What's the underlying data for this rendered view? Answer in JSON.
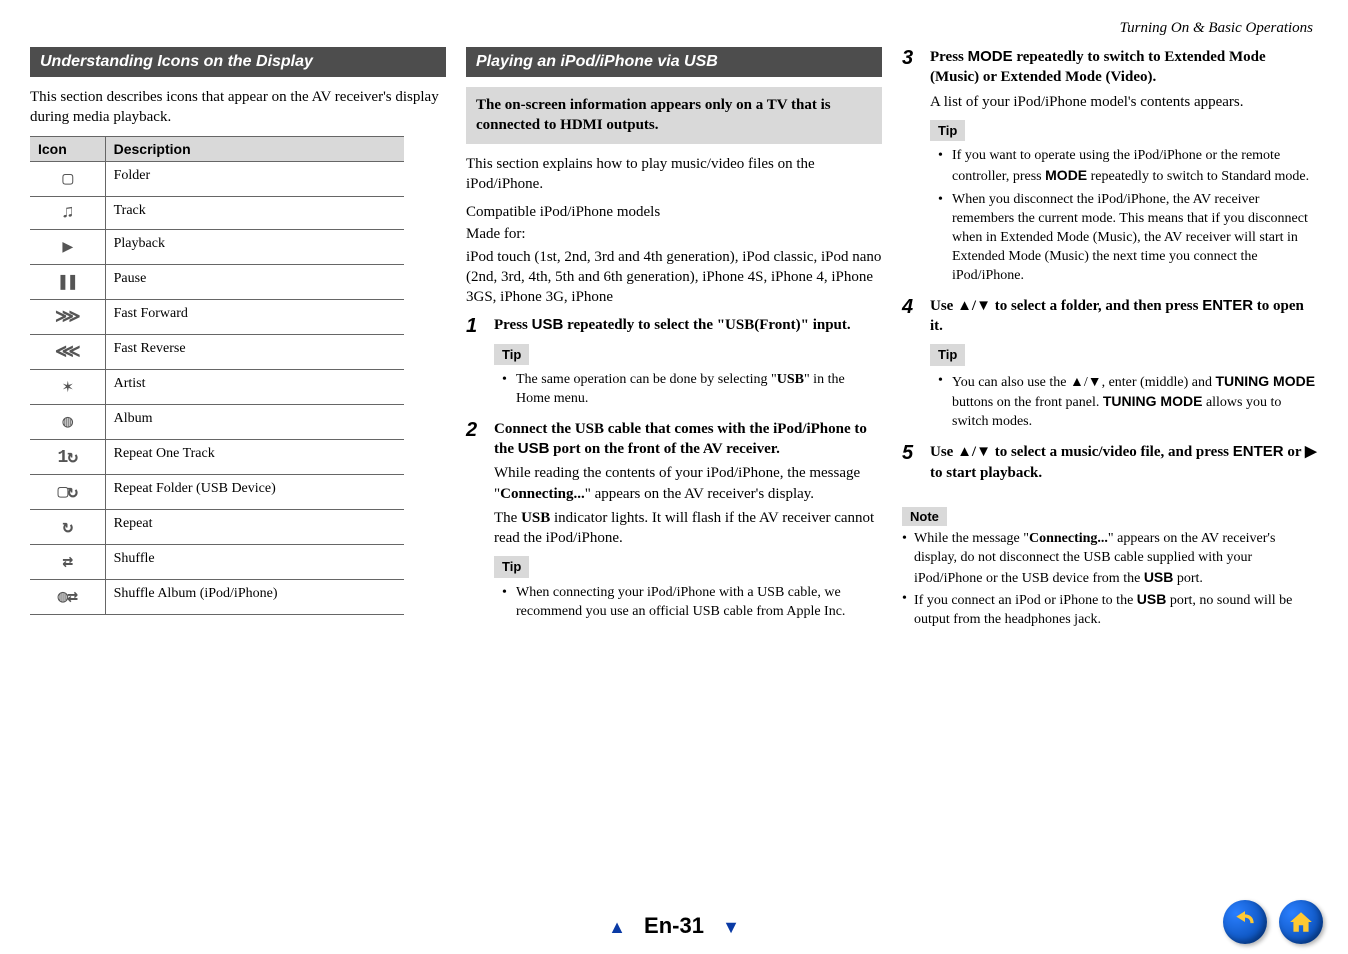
{
  "header": {
    "top_right": "Turning On & Basic Operations"
  },
  "col1": {
    "header": "Understanding Icons on the Display",
    "intro": "This section describes icons that appear on the AV receiver's display during media playback.",
    "table_headers": {
      "icon": "Icon",
      "desc": "Description"
    },
    "rows": [
      {
        "glyph": "▢",
        "desc": "Folder"
      },
      {
        "glyph": "♫",
        "desc": "Track"
      },
      {
        "glyph": "▶",
        "desc": "Playback"
      },
      {
        "glyph": "❚❚",
        "desc": "Pause"
      },
      {
        "glyph": "⋙",
        "desc": "Fast Forward"
      },
      {
        "glyph": "⋘",
        "desc": "Fast Reverse"
      },
      {
        "glyph": "✶",
        "desc": "Artist"
      },
      {
        "glyph": "◍",
        "desc": "Album"
      },
      {
        "glyph": "1↻",
        "desc": "Repeat One Track"
      },
      {
        "glyph": "▢↻",
        "desc": "Repeat Folder (USB Device)"
      },
      {
        "glyph": "↻",
        "desc": "Repeat"
      },
      {
        "glyph": "⇄",
        "desc": "Shuffle"
      },
      {
        "glyph": "◍⇄",
        "desc": "Shuffle Album (iPod/iPhone)"
      }
    ]
  },
  "col2": {
    "header": "Playing an iPod/iPhone via USB",
    "callout": "The on-screen information appears only on a TV that is connected to HDMI outputs.",
    "intro1": "This section explains how to play music/video files on the iPod/iPhone.",
    "intro2": "Compatible iPod/iPhone models",
    "intro3": "Made for:",
    "intro4": "iPod touch (1st, 2nd, 3rd and 4th generation), iPod classic, iPod nano (2nd, 3rd, 4th, 5th and 6th generation), iPhone 4S, iPhone 4, iPhone 3GS, iPhone 3G, iPhone",
    "step1_main_a": "Press ",
    "step1_main_b": "USB",
    "step1_main_c": " repeatedly to select the \"USB(Front)\" input.",
    "tip1_label": "Tip",
    "tip1_li_a": "The same operation can be done by selecting \"",
    "tip1_li_b": "USB",
    "tip1_li_c": "\" in the Home menu.",
    "step2_main_a": "Connect the USB cable that comes with the iPod/iPhone to the ",
    "step2_main_b": "USB",
    "step2_main_c": " port on the front of the AV receiver.",
    "step2_sub_a": "While reading the contents of your iPod/iPhone, the message \"",
    "step2_sub_b": "Connecting...",
    "step2_sub_c": "\" appears on the AV receiver's display.",
    "step2_sub_d": "The ",
    "step2_sub_e": "USB",
    "step2_sub_f": " indicator lights. It will flash if the AV receiver cannot read the iPod/iPhone.",
    "tip2_label": "Tip",
    "tip2_li": "When connecting your iPod/iPhone with a USB cable, we recommend you use an official USB cable from Apple Inc."
  },
  "col3": {
    "step3_main_a": "Press ",
    "step3_main_b": "MODE",
    "step3_main_c": " repeatedly to switch to Extended Mode (Music) or Extended Mode (Video).",
    "step3_sub": "A list of your iPod/iPhone model's contents appears.",
    "tip3_label": "Tip",
    "tip3_li1_a": "If you want to operate using the iPod/iPhone or the remote controller, press ",
    "tip3_li1_b": "MODE",
    "tip3_li1_c": " repeatedly to switch to Standard mode.",
    "tip3_li2": "When you disconnect the iPod/iPhone, the AV receiver remembers the current mode. This means that if you disconnect when in Extended Mode (Music), the AV receiver will start in Extended Mode (Music) the next time you connect the iPod/iPhone.",
    "step4_main_a": "Use ",
    "step4_main_b": "▲/▼",
    "step4_main_c": " to select a folder, and then press ",
    "step4_main_d": "ENTER",
    "step4_main_e": " to open it.",
    "tip4_label": "Tip",
    "tip4_li_a": "You can also use the ",
    "tip4_li_b": "▲/▼",
    "tip4_li_c": ", enter (middle) and ",
    "tip4_li_d": "TUNING MODE",
    "tip4_li_e": " buttons on the front panel. ",
    "tip4_li_f": "TUNING MODE",
    "tip4_li_g": " allows you to switch modes.",
    "step5_main_a": "Use ",
    "step5_main_b": "▲/▼",
    "step5_main_c": " to select a music/video file, and press ",
    "step5_main_d": "ENTER",
    "step5_main_e": " or ",
    "step5_main_f": "▶",
    "step5_main_g": " to start playback.",
    "note_label": "Note",
    "note_li1_a": "While the message \"",
    "note_li1_b": "Connecting...",
    "note_li1_c": "\" appears on the AV receiver's display, do not disconnect the USB cable supplied with your iPod/iPhone or the USB device from the ",
    "note_li1_d": "USB",
    "note_li1_e": " port.",
    "note_li2_a": "If you connect an iPod or iPhone to the ",
    "note_li2_b": "USB",
    "note_li2_c": " port, no sound will be output from the headphones jack."
  },
  "footer": {
    "page": "En-31"
  }
}
